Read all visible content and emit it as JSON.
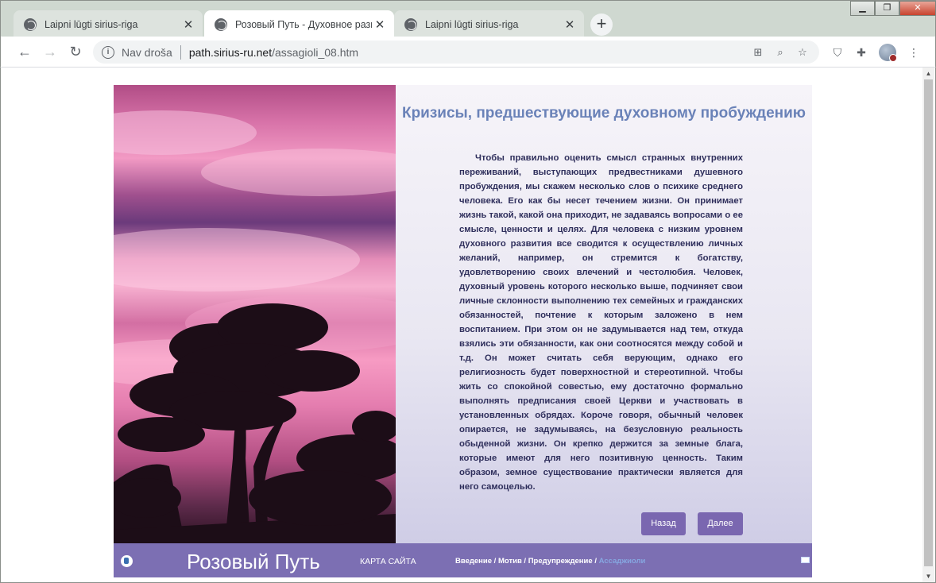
{
  "browser": {
    "tabs": [
      {
        "title": "Laipni lūgti sirius-riga",
        "close": "✕"
      },
      {
        "title": "Розовый Путь - Духовное разв",
        "close": "✕"
      },
      {
        "title": "Laipni lūgti sirius-riga",
        "close": "✕"
      }
    ],
    "new_tab": "+",
    "window_controls": {
      "minimize": "▁",
      "maximize": "❐",
      "close": "✕"
    },
    "nav": {
      "back": "←",
      "forward": "→",
      "reload": "↻"
    },
    "security_label": "Nav droša",
    "url_host": "path.sirius-ru.net",
    "url_path": "/assagioli_08.htm"
  },
  "page": {
    "heading": "Кризисы, предшествующие духовному пробуждению",
    "paragraph": "Чтобы правильно оценить смысл странных внутренних переживаний, выступающих предвестниками душевного пробуждения, мы скажем несколько слов о психике среднего человека. Его как бы несет течением жизни. Он принимает жизнь такой, какой она приходит, не задаваясь вопросами о ее смысле, ценности и целях. Для человека с низким уровнем духовного развития все сводится к осуществлению личных желаний, например, он стремится к богатству, удовлетворению своих влечений и честолюбия. Человек, духовный уровень которого несколько выше, подчиняет свои личные склонности выполнению тех семейных и гражданских обязанностей, почтение к которым заложено в нем воспитанием. При этом он не задумывается над тем, откуда взялись эти обязанности, как они соотносятся между собой и т.д. Он может считать себя верующим, однако его религиозность будет поверхностной и стереотипной. Чтобы жить со спокойной совестью, ему достаточно формально выполнять предписания своей Церкви и участвовать в установленных обрядах. Короче говоря, обычный человек опирается, не задумываясь, на безусловную реальность обыденной жизни. Он крепко держится за земные блага, которые имеют для него позитивную ценность. Таким образом, земное существование практически является для него самоцелью.",
    "back_button": "Назад",
    "next_button": "Далее"
  },
  "footer": {
    "brand": "Розовый Путь",
    "sitemap": "КАРТА САЙТА",
    "breadcrumbs": [
      "Введение",
      "Мотив",
      "Предупреждение"
    ],
    "current": "Ассаджиоли",
    "separator": " / "
  },
  "colors": {
    "accent": "#7c6fb3",
    "heading": "#6a82b8",
    "body_text": "#2f2f5c"
  }
}
